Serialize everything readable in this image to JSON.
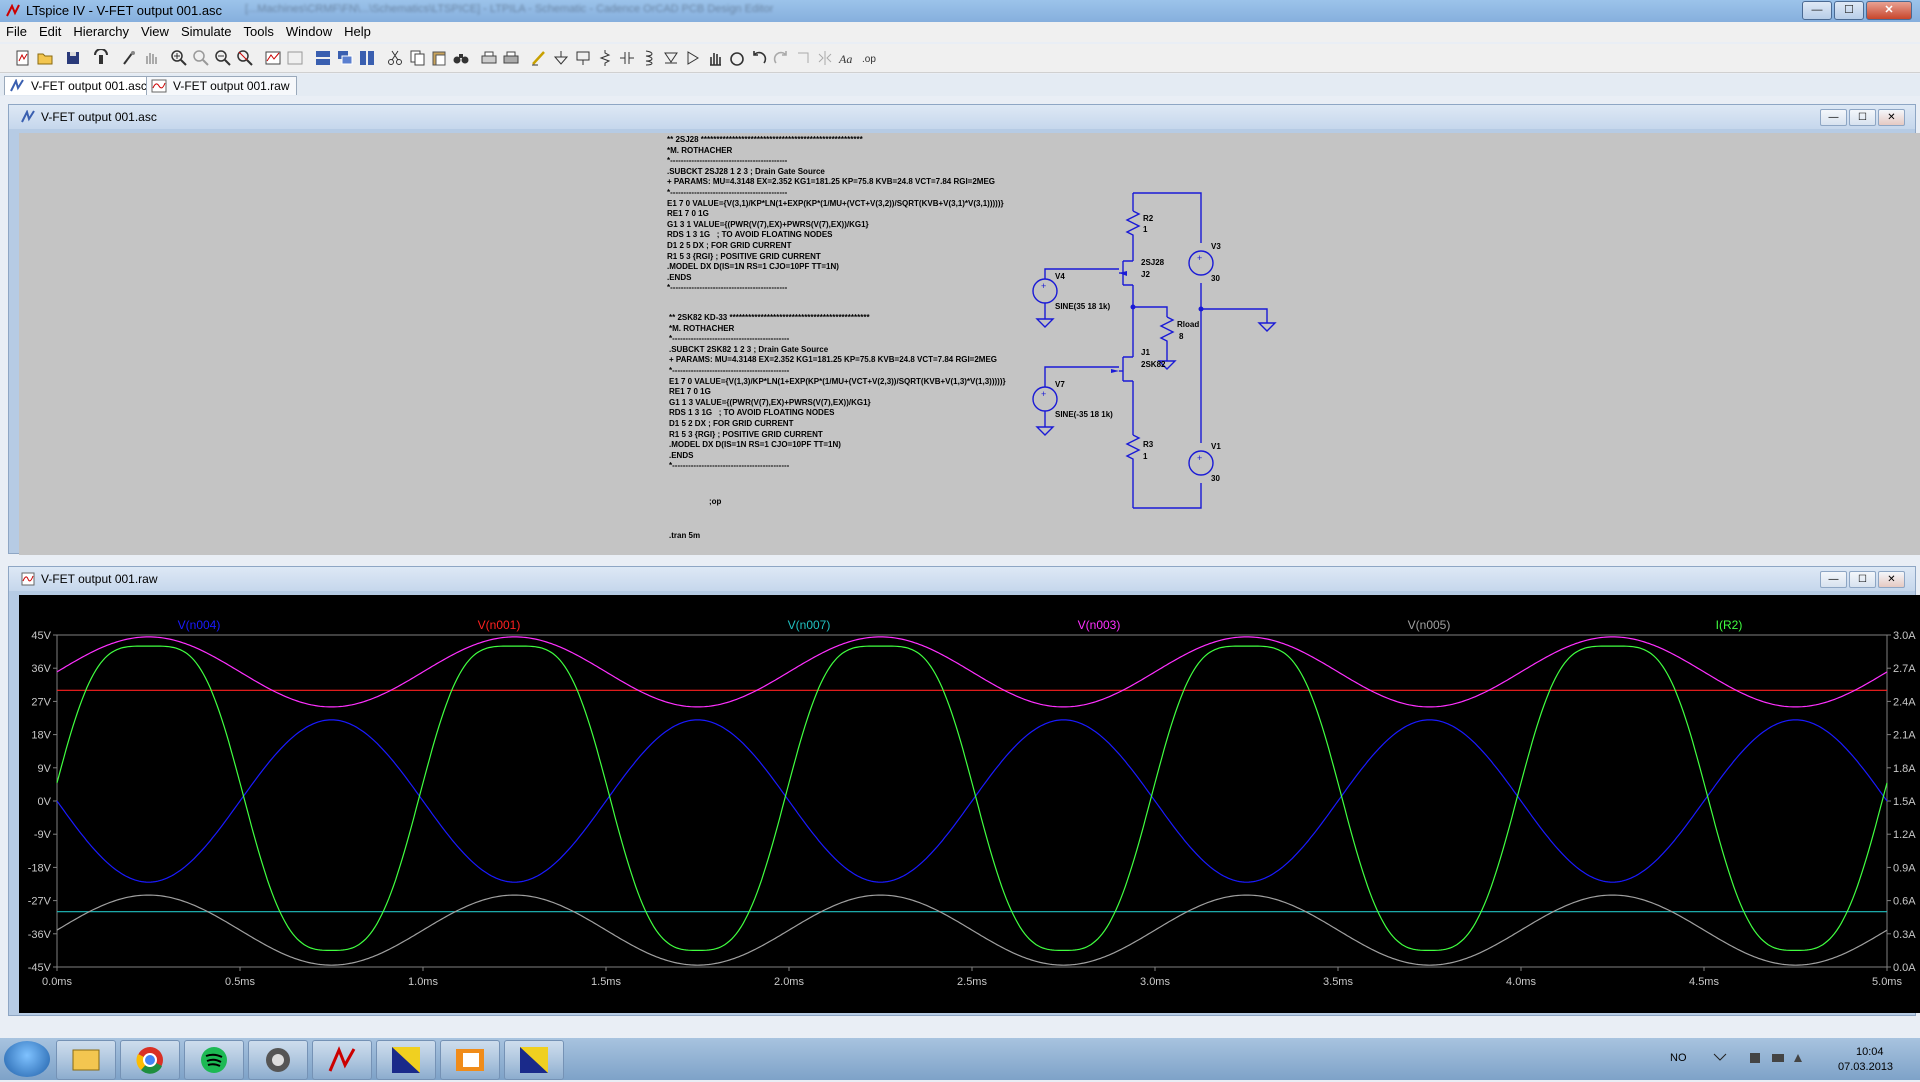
{
  "window": {
    "title": "LTspice IV - V-FET output 001.asc",
    "path_blurred": "[...Machines\\CRMF\\FN\\...\\Schematics\\LTSPICE] - LTPILA - Schematic - Cadence OrCAD PCB Design Editor",
    "buttons": [
      "—",
      "☐",
      "✕"
    ]
  },
  "menu": [
    "File",
    "Edit",
    "Hierarchy",
    "View",
    "Simulate",
    "Tools",
    "Window",
    "Help"
  ],
  "tabs": [
    {
      "label": "V-FET output 001.asc",
      "icon": "schematic-icon"
    },
    {
      "label": "V-FET output 001.raw",
      "icon": "waveform-icon"
    }
  ],
  "schematic_window": {
    "title": "V-FET output 001.asc",
    "netlist1": "** 2SJ28 ****************************************************\n*M. ROTHACHER\n*--------------------------------------------\n.SUBCKT 2SJ28 1 2 3 ; Drain Gate Source\n+ PARAMS: MU=4.3148 EX=2.352 KG1=181.25 KP=75.8 KVB=24.8 VCT=7.84 RGI=2MEG\n*--------------------------------------------\nE1 7 0 VALUE={V(3,1)/KP*LN(1+EXP(KP*(1/MU+(VCT+V(3,2))/SQRT(KVB+V(3,1)*V(3,1)))))}\nRE1 7 0 1G\nG1 3 1 VALUE={(PWR(V(7),EX)+PWRS(V(7),EX))/KG1}\nRDS 1 3 1G   ; TO AVOID FLOATING NODES\nD1 2 5 DX ; FOR GRID CURRENT\nR1 5 3 {RGI} ; POSITIVE GRID CURRENT\n.MODEL DX D(IS=1N RS=1 CJO=10PF TT=1N)\n.ENDS\n*--------------------------------------------",
    "netlist2": "** 2SK82 KD-33 *********************************************\n*M. ROTHACHER\n*--------------------------------------------\n.SUBCKT 2SK82 1 2 3 ; Drain Gate Source\n+ PARAMS: MU=4.3148 EX=2.352 KG1=181.25 KP=75.8 KVB=24.8 VCT=7.84 RGI=2MEG\n*--------------------------------------------\nE1 7 0 VALUE={V(1,3)/KP*LN(1+EXP(KP*(1/MU+(VCT+V(2,3))/SQRT(KVB+V(1,3)*V(1,3)))))}\nRE1 7 0 1G\nG1 1 3 VALUE={(PWR(V(7),EX)+PWRS(V(7),EX))/KG1}\nRDS 1 3 1G   ; TO AVOID FLOATING NODES\nD1 5 2 DX ; FOR GRID CURRENT\nR1 5 3 {RGI} ; POSITIVE GRID CURRENT\n.MODEL DX D(IS=1N RS=1 CJO=10PF TT=1N)\n.ENDS\n*--------------------------------------------",
    "op_directive": ";op",
    "tran_directive": ".tran 5m",
    "parts": {
      "R2": {
        "name": "R2",
        "value": "1"
      },
      "R3": {
        "name": "R3",
        "value": "1"
      },
      "Rload": {
        "name": "Rload",
        "value": "8"
      },
      "J2": {
        "name": "J2",
        "model": "2SJ28"
      },
      "J1": {
        "name": "J1",
        "model": "2SK82"
      },
      "V3": {
        "name": "V3",
        "value": "30"
      },
      "V1": {
        "name": "V1",
        "value": "30"
      },
      "V4": {
        "name": "V4",
        "value": "SINE(35 18 1k)"
      },
      "V7": {
        "name": "V7",
        "value": "SINE(-35 18 1k)"
      }
    }
  },
  "waveform_window": {
    "title": "V-FET output 001.raw",
    "traces": [
      {
        "name": "V(n004)",
        "color": "#1a1aff"
      },
      {
        "name": "V(n001)",
        "color": "#ff2020"
      },
      {
        "name": "V(n007)",
        "color": "#20c0c0"
      },
      {
        "name": "V(n003)",
        "color": "#ff30ff"
      },
      {
        "name": "V(n005)",
        "color": "#a0a0a0"
      },
      {
        "name": "I(R2)",
        "color": "#40ff40"
      }
    ],
    "left_axis": [
      "45V",
      "36V",
      "27V",
      "18V",
      "9V",
      "0V",
      "-9V",
      "-18V",
      "-27V",
      "-36V",
      "-45V"
    ],
    "right_axis": [
      "3.0A",
      "2.7A",
      "2.4A",
      "2.1A",
      "1.8A",
      "1.5A",
      "1.2A",
      "0.9A",
      "0.6A",
      "0.3A",
      "0.0A"
    ],
    "x_axis": [
      "0.0ms",
      "0.5ms",
      "1.0ms",
      "1.5ms",
      "2.0ms",
      "2.5ms",
      "3.0ms",
      "3.5ms",
      "4.0ms",
      "4.5ms",
      "5.0ms"
    ]
  },
  "chart_data": {
    "type": "line",
    "xlabel": "",
    "ylabel": "",
    "xlim": [
      0,
      5
    ],
    "ylim_left": [
      -45,
      45
    ],
    "ylim_right": [
      0,
      3
    ],
    "x_unit": "ms",
    "series": [
      {
        "name": "V(n004)",
        "axis": "left",
        "offset": 0,
        "amplitude": 22,
        "phase": "-sin",
        "freq_khz": 1
      },
      {
        "name": "V(n001)",
        "axis": "left",
        "constant": 30
      },
      {
        "name": "V(n007)",
        "axis": "left",
        "constant": -30
      },
      {
        "name": "V(n003)",
        "axis": "left",
        "offset": 35,
        "amplitude": 9.5,
        "phase": "+sin",
        "freq_khz": 1
      },
      {
        "name": "V(n005)",
        "axis": "left",
        "offset": -35,
        "amplitude": 9.5,
        "phase": "+sin",
        "freq_khz": 1
      },
      {
        "name": "I(R2)",
        "axis": "right",
        "min": 0.15,
        "max": 2.9,
        "freq_khz": 1
      }
    ]
  },
  "taskbar": {
    "lang": "NO",
    "time": "10:04",
    "date": "07.03.2013"
  }
}
